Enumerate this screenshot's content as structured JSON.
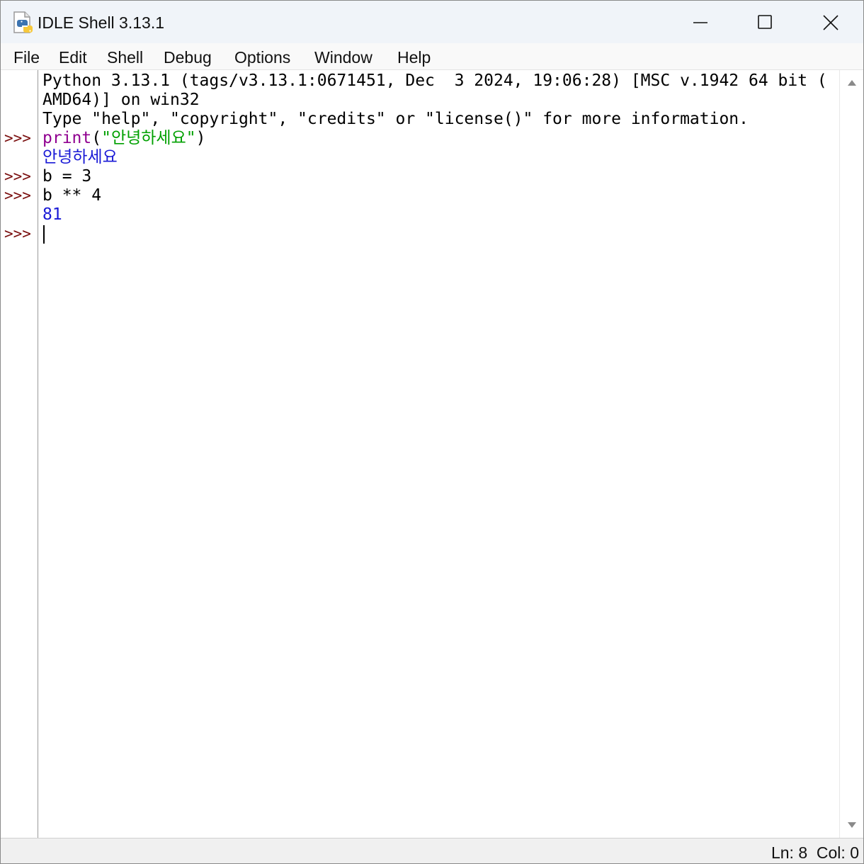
{
  "window": {
    "title": "IDLE Shell 3.13.1"
  },
  "menu": {
    "items": [
      "File",
      "Edit",
      "Shell",
      "Debug",
      "Options",
      "Window",
      "Help"
    ]
  },
  "shell": {
    "prompt": ">>>",
    "banner_line1": "Python 3.13.1 (tags/v3.13.1:0671451, Dec  3 2024, 19:06:28) [MSC v.1942 64 bit (",
    "banner_line2": "AMD64)] on win32",
    "banner_line3": "Type \"help\", \"copyright\", \"credits\" or \"license()\" for more information.",
    "cmd1_builtin": "print",
    "cmd1_open": "(",
    "cmd1_string": "\"안녕하세요\"",
    "cmd1_close": ")",
    "out1": "안녕하세요",
    "cmd2": "b = 3",
    "cmd3": "b ** 4",
    "out3": "81"
  },
  "status": {
    "position": "Ln: 8  Col: 0"
  },
  "icons": {
    "app": "python-idle-icon",
    "minimize": "minimize-icon",
    "maximize": "maximize-icon",
    "close": "close-icon",
    "scroll_up": "scroll-up-arrow-icon",
    "scroll_down": "scroll-down-arrow-icon"
  },
  "colors": {
    "prompt": "#7a0f0f",
    "builtin": "#900090",
    "string": "#00a000",
    "output": "#1a1ad6"
  }
}
